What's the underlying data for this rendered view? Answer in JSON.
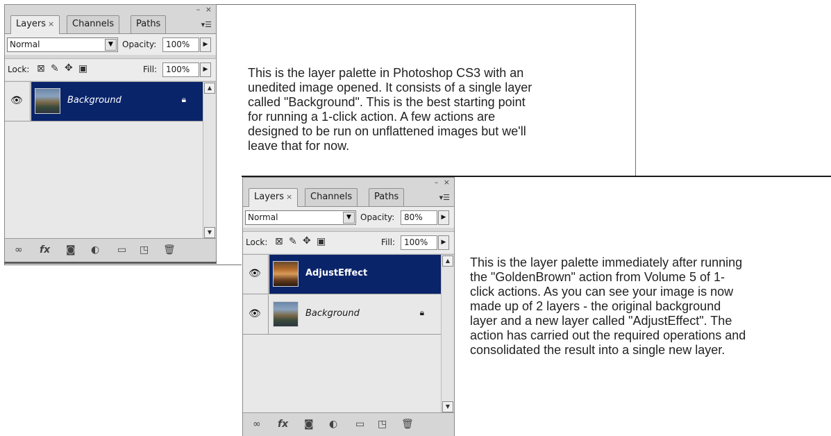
{
  "panels": [
    {
      "tabs": [
        {
          "label": "Layers"
        },
        {
          "label": "Channels"
        },
        {
          "label": "Paths"
        }
      ],
      "window_controls": "– ×",
      "blend_mode": "Normal",
      "opacity_label": "Opacity:",
      "opacity_value": "100%",
      "lock_label": "Lock:",
      "fill_label": "Fill:",
      "fill_value": "100%",
      "layers": [
        {
          "name": "Background",
          "selected": true,
          "locked": true
        }
      ]
    },
    {
      "tabs": [
        {
          "label": "Layers"
        },
        {
          "label": "Channels"
        },
        {
          "label": "Paths"
        }
      ],
      "window_controls": "– ×",
      "blend_mode": "Normal",
      "opacity_label": "Opacity:",
      "opacity_value": "80%",
      "lock_label": "Lock:",
      "fill_label": "Fill:",
      "fill_value": "100%",
      "layers": [
        {
          "name": "AdjustEffect",
          "selected": true,
          "locked": false
        },
        {
          "name": "Background",
          "selected": false,
          "locked": true
        }
      ]
    }
  ],
  "descriptions": {
    "top": [
      "This is the layer palette in Photoshop CS3 with an",
      "unedited image opened. It consists of a single layer",
      "called \"Background\". This is the best starting point",
      "for running a 1-click action. A few actions are",
      "designed to be run on unflattened images but we'll",
      "leave that for now."
    ],
    "bottom": [
      "This is the layer palette immediately after running",
      "the \"GoldenBrown\" action from Volume 5 of 1-",
      "click actions. As you can see your image is now",
      "made up of 2 layers - the original background",
      "layer and a new layer called \"AdjustEffect\". The",
      "action has carried out the required operations and",
      "consolidated the result into a single new layer."
    ]
  },
  "icons": {
    "eye": "eye-icon",
    "lock": "lock-icon",
    "link": "link-layers-icon",
    "fx": "fx-icon",
    "mask": "layer-mask-icon",
    "adjust": "adjustment-layer-icon",
    "group": "folder-icon",
    "new": "new-layer-icon",
    "trash": "trash-icon"
  },
  "colors": {
    "selected_row": "#0a246a",
    "panel_bg": "#d7d7d7"
  }
}
